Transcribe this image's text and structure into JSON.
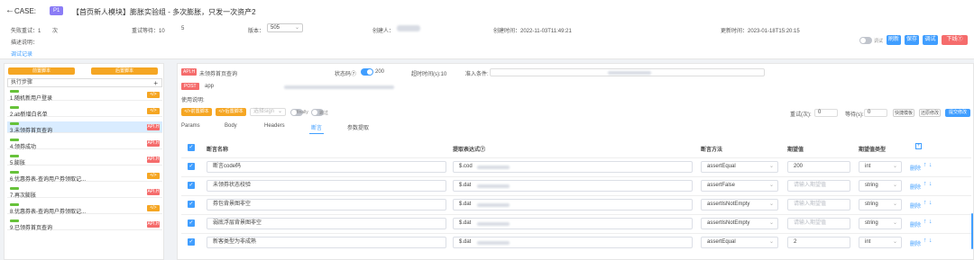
{
  "header": {
    "back_icon": "arrow-left-icon",
    "case_label": "CASE:",
    "priority": "P1",
    "title": "【首页新人模块】膨胀实验组 - 多次膨胀，只发一次资产2",
    "fail_retry_label": "失败重试：1",
    "fail_retry_unit": "次",
    "retry_wait_label": "重试等待：10",
    "retry_wait_value": "5",
    "version_label": "版本：",
    "version_value": "505",
    "creator_label": "创建人：",
    "created_label": "创建时间：2022-11-03T11:49:21",
    "updated_label": "更新时间：2023-01-18T15:20:15",
    "desc_label": "描述说明：",
    "debug_log": "调试记录"
  },
  "actions": {
    "toggle_label": "调试",
    "refresh": "刷新",
    "save": "保存",
    "debug": "调试",
    "offline": "下线⑦"
  },
  "left": {
    "pre_script": "前置脚本",
    "post_script": "后置脚本",
    "steps_header": "执行步骤",
    "add": "+",
    "steps": [
      {
        "name": "1.随机新用户登录",
        "type": "</>"
      },
      {
        "name": "2.ab新增白名单",
        "type": "</>"
      },
      {
        "name": "3.未领券首页查询",
        "type": "API.H"
      },
      {
        "name": "4.领券成功",
        "type": "API.H"
      },
      {
        "name": "5.膨胀",
        "type": "API.H"
      },
      {
        "name": "6.优惠券表-查询用户券领取记...",
        "type": "</>"
      },
      {
        "name": "7.再次膨胀",
        "type": "API.H"
      },
      {
        "name": "8.优惠券表-查询用户券领取记...",
        "type": "</>"
      },
      {
        "name": "9.已领券首页查询",
        "type": "API.H"
      }
    ]
  },
  "detail": {
    "api_tag": "API.H",
    "api_name": "未领券首页查询",
    "status_label": "状态码⑦",
    "status_value": "200",
    "timeout_label": "超时时间(s):10",
    "condition_label": "准入条件:",
    "method": "POST",
    "path": "app",
    "desc_label": "使用说明:",
    "pre_script_btn": "</>前置脚本",
    "post_script_btn": "</>后置脚本",
    "select_sign": "选择sign",
    "finally_label": "finally",
    "skip_label": "跳过",
    "retry_label": "重试(次):",
    "retry_value": "0",
    "wait_label": "等待(s):",
    "wait_value": "0",
    "quick_template": "快捷模板",
    "restore": "还原修改",
    "submit": "提交修改"
  },
  "tabs": [
    "Params",
    "Body",
    "Headers",
    "断言",
    "参数提取"
  ],
  "table": {
    "columns": [
      "断言名称",
      "提取表达式⑦",
      "断言方法",
      "期望值",
      "期望值类型"
    ],
    "delete_label": "删除",
    "rows": [
      {
        "name": "断言code码",
        "expr": "$.cod",
        "method": "assertEqual",
        "expect": "200",
        "expect_type": "int"
      },
      {
        "name": "未领券状态校验",
        "expr": "$.dat",
        "method": "assertFalse",
        "expect": "请输入期望值",
        "expect_type": "string"
      },
      {
        "name": "券包背景图非空",
        "expr": "$.dat",
        "method": "assertIsNotEmpty",
        "expect": "请输入期望值",
        "expect_type": "string"
      },
      {
        "name": "弱底浮层背景图非空",
        "expr": "$.dat",
        "method": "assertIsNotEmpty",
        "expect": "请输入期望值",
        "expect_type": "string"
      },
      {
        "name": "新客类型为非成熟",
        "expr": "$.dat",
        "method": "assertEqual",
        "expect": "2",
        "expect_type": "int"
      }
    ]
  },
  "colors": {
    "accent": "#409eff",
    "danger": "#f56c6c",
    "warn": "#f5a623",
    "success": "#67c23a",
    "priority": "#8b7cf6"
  }
}
